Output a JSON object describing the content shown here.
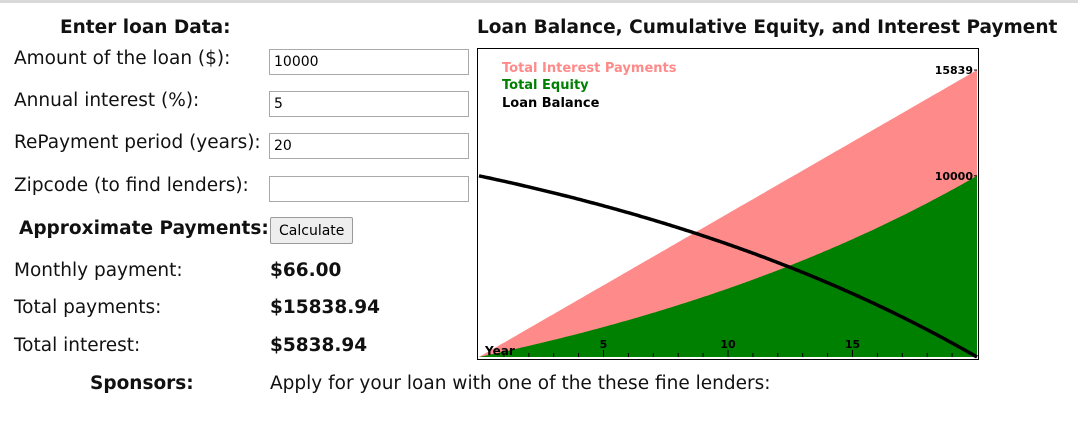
{
  "form": {
    "heading": "Enter loan Data:",
    "fields": [
      {
        "label": "Amount of the loan ($):",
        "value": "10000"
      },
      {
        "label": "Annual interest (%):",
        "value": "5"
      },
      {
        "label": "RePayment period (years):",
        "value": "20"
      },
      {
        "label": "Zipcode (to find lenders):",
        "value": ""
      }
    ],
    "approx_label": "Approximate Payments:",
    "calculate_label": "Calculate",
    "results": [
      {
        "label": "Monthly payment:",
        "value": "$66.00"
      },
      {
        "label": "Total payments:",
        "value": "$15838.94"
      },
      {
        "label": "Total interest:",
        "value": "$5838.94"
      }
    ],
    "sponsors_label": "Sponsors:",
    "sponsors_text": "Apply for your loan with one of the these fine lenders:"
  },
  "chart_data": {
    "type": "area",
    "title": "Loan Balance, Cumulative Equity, and Interest Payment",
    "xlabel": "Year",
    "x_ticks": [
      "5",
      "10",
      "15"
    ],
    "xlim": [
      0,
      20
    ],
    "ylim": [
      0,
      17000
    ],
    "legend_position": "top-left",
    "series": [
      {
        "name": "Total Interest Payments",
        "color": "#ff8a8a",
        "values_total_payments": [
          0,
          15838.94
        ]
      },
      {
        "name": "Total Equity",
        "color": "#008000",
        "values": [
          0,
          10000
        ]
      },
      {
        "name": "Loan Balance",
        "color": "#000000",
        "values": [
          10000,
          0
        ]
      }
    ],
    "annotations": [
      {
        "label": "15839",
        "value": 15839
      },
      {
        "label": "10000",
        "value": 10000
      }
    ],
    "loan": {
      "principal": 10000,
      "rate_percent": 5,
      "years": 20
    }
  }
}
